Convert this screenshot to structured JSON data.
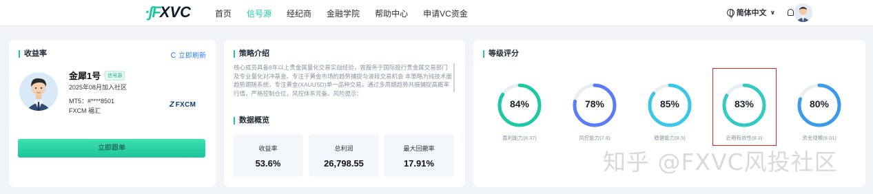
{
  "nav": {
    "logo_mark": "·ʃF",
    "logo_name": "XVC",
    "items": [
      {
        "label": "首页",
        "active": false
      },
      {
        "label": "信号源",
        "active": true
      },
      {
        "label": "经纪商",
        "active": false
      },
      {
        "label": "金融学院",
        "active": false
      },
      {
        "label": "帮助中心",
        "active": false
      },
      {
        "label": "申请VC资金",
        "active": false
      }
    ],
    "language": "简体中文"
  },
  "returns_card": {
    "title": "收益率",
    "refresh_label": "立即刷新",
    "name": "金犀1号",
    "badge": "信号源",
    "joined": "2025年08月加入社区",
    "mt5": "MT5：#****8501",
    "broker": "FXCM 福汇",
    "broker_logo": "FXCM",
    "follow_label": "立即跟单"
  },
  "strategy_card": {
    "title": "策略介绍",
    "description": "核心成员具备8年以上贵金属量化交易实战经验，曾服务于国际投行贵金属交易部门及专业量化对冲基金。专注于黄金市场的趋势捕捉与波段交易机会 本策略为纯技术面趋势跟随系统，专注黄金(XAUUSD)单一品种交易，通过多周期趋势共振捕捉高概率行情，严格控制仓位，风控体系完备。风险提示：",
    "overview_title": "数据概览",
    "stats": [
      {
        "label": "收益率",
        "value": "53.6%"
      },
      {
        "label": "总利润",
        "value": "26,798.55"
      },
      {
        "label": "最大回撤率",
        "value": "17.91%"
      }
    ]
  },
  "rating_card": {
    "title": "等级评分",
    "gauges": [
      {
        "value": "84%",
        "percent": 84,
        "label": "盈利能力(8.37)",
        "color": "#1fc8a5"
      },
      {
        "value": "78%",
        "percent": 78,
        "label": "风控能力(7.8)",
        "color": "#5b7cf6"
      },
      {
        "value": "85%",
        "percent": 85,
        "label": "稳健能力(8.5)",
        "color": "#3dc7e6"
      },
      {
        "value": "83%",
        "percent": 83,
        "label": "近期有效性(8.3)",
        "color": "#35c9c4"
      },
      {
        "value": "80%",
        "percent": 80,
        "label": "资金规模(8.01)",
        "color": "#3a9bea"
      }
    ]
  },
  "watermark": "知乎 @FXVC风投社区"
}
